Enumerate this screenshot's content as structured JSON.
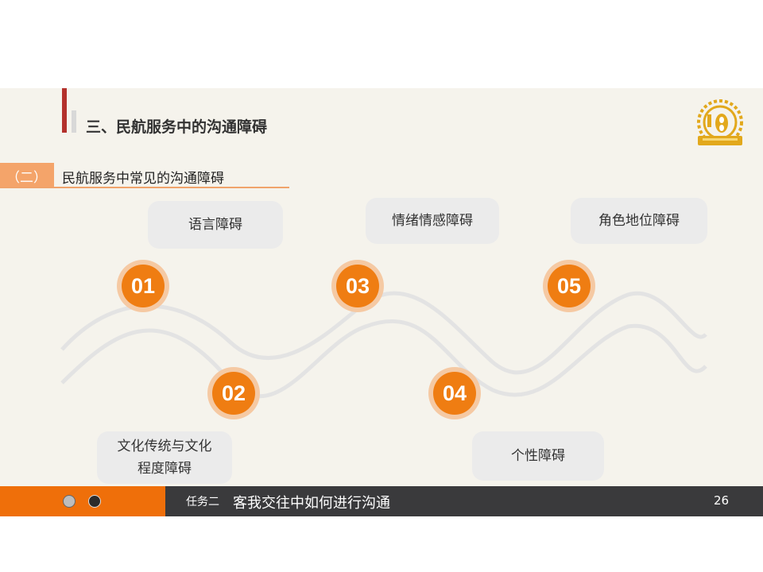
{
  "header": {
    "title": "三、民航服务中的沟通障碍"
  },
  "subsection": {
    "index_label": "（二）",
    "title": "民航服务中常见的沟通障碍"
  },
  "items": [
    {
      "number": "01",
      "label": "语言障碍"
    },
    {
      "number": "02",
      "label_line1": "文化传统与文化",
      "label_line2": "程度障碍"
    },
    {
      "number": "03",
      "label": "情绪情感障碍"
    },
    {
      "number": "04",
      "label": "个性障碍"
    },
    {
      "number": "05",
      "label": "角色地位障碍"
    }
  ],
  "footer": {
    "task_label": "任务二",
    "title": "客我交往中如何进行沟通",
    "page_number": "26"
  },
  "colors": {
    "accent_orange": "#ef7d12",
    "footer_orange": "#ef6f0a",
    "footer_dark": "#3a3a3c",
    "title_red": "#b3312c",
    "background": "#f5f3ec"
  },
  "icons": {
    "logo": "golden-seal-logo",
    "dots": [
      "gray-dot-icon",
      "dark-dot-icon"
    ]
  }
}
